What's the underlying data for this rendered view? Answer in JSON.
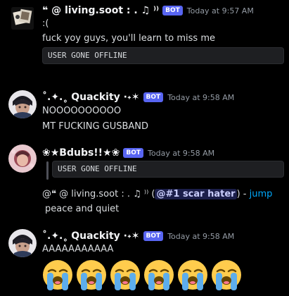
{
  "messages": [
    {
      "username": "❝ @ living.soot : . ♫ ⁾⁾",
      "bot_tag": "BOT",
      "timestamp": "Today at 9:57 AM",
      "lines": [
        ":(",
        "fuck yoy guys, you'll learn to miss me"
      ],
      "code": "USER GONE OFFLINE"
    },
    {
      "username": "˚.✦.˳ Quackity ·˖✶",
      "bot_tag": "BOT",
      "timestamp": "Today at 9:58 AM",
      "lines": [
        "NOOOOOOOOOO",
        "MT FUCKING GUSBAND"
      ]
    },
    {
      "username": "❀★Bdubs!!★❀",
      "bot_tag": "BOT",
      "timestamp": "Today at 9:58 AM",
      "quote_code": "USER GONE OFFLINE",
      "reply_prefix": "@❝ @ living.soot : . ♫ ⁾⁾ (",
      "reply_mention": "@#1 scar hater",
      "reply_mid": ") - ",
      "reply_link": "jump",
      "line": "peace and quiet"
    },
    {
      "username": "˚.✦.˳ Quackity ·˖✶",
      "bot_tag": "BOT",
      "timestamp": "Today at 9:58 AM",
      "line": "AAAAAAAAAAA",
      "emoji_count": "6",
      "emoji_name": "loudly-crying-face"
    }
  ],
  "colors": {
    "background": "#000000",
    "bot_tag": "#5865f2",
    "link": "#00a8fc",
    "mention_bg": "#3c437a"
  }
}
